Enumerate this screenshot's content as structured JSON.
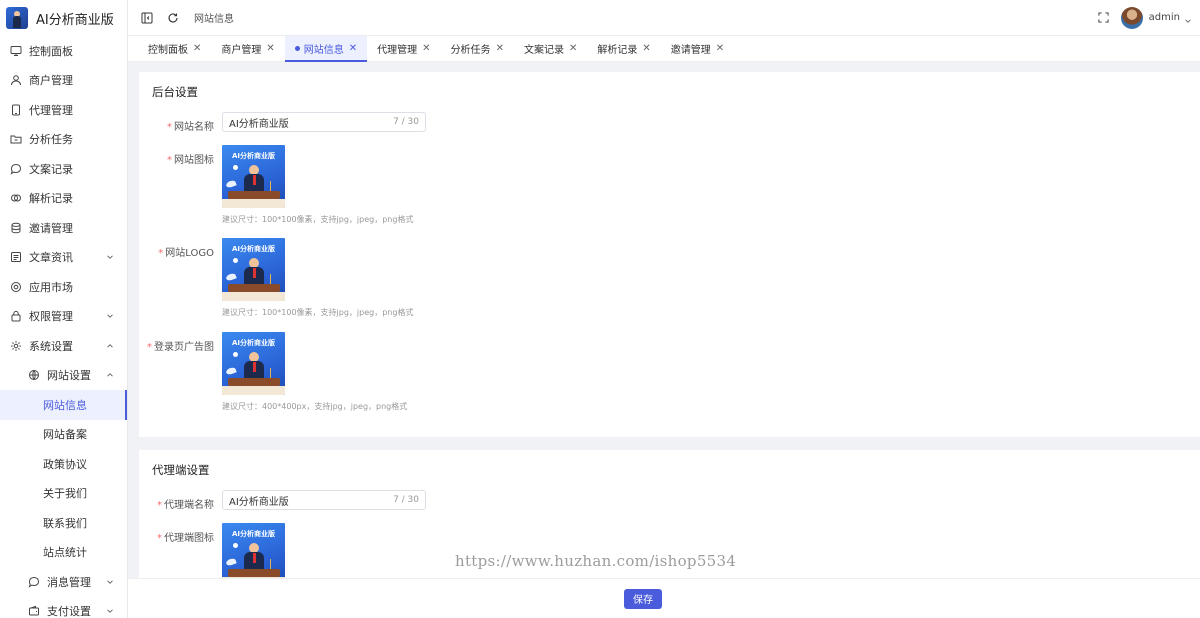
{
  "app": {
    "title": "AI分析商业版"
  },
  "sidebar": {
    "items": [
      {
        "label": "控制面板",
        "icon": "monitor-icon"
      },
      {
        "label": "商户管理",
        "icon": "user-icon"
      },
      {
        "label": "代理管理",
        "icon": "tablet-icon"
      },
      {
        "label": "分析任务",
        "icon": "folder-icon"
      },
      {
        "label": "文案记录",
        "icon": "chat-bubble-icon"
      },
      {
        "label": "解析记录",
        "icon": "link-icon"
      },
      {
        "label": "邀请管理",
        "icon": "database-icon"
      },
      {
        "label": "文章资讯",
        "icon": "document-icon",
        "caret": "down"
      },
      {
        "label": "应用市场",
        "icon": "settings-wheel-icon"
      },
      {
        "label": "权限管理",
        "icon": "lock-icon",
        "caret": "down"
      },
      {
        "label": "系统设置",
        "icon": "gear-icon",
        "caret": "up"
      }
    ],
    "sub_group": {
      "label": "网站设置",
      "icon": "globe-icon",
      "caret": "up"
    },
    "sub_items": [
      "网站信息",
      "网站备案",
      "政策协议",
      "关于我们",
      "联系我们",
      "站点统计"
    ],
    "more_groups": [
      {
        "label": "消息管理",
        "icon": "chat-bubble-icon",
        "caret": "down"
      },
      {
        "label": "支付设置",
        "icon": "wallet-icon",
        "caret": "down"
      }
    ]
  },
  "header": {
    "breadcrumb": "网站信息",
    "username": "admin"
  },
  "tabs": [
    "控制面板",
    "商户管理",
    "网站信息",
    "代理管理",
    "分析任务",
    "文案记录",
    "解析记录",
    "邀请管理"
  ],
  "active_tab": "网站信息",
  "backend": {
    "title": "后台设置",
    "site_name_label": "网站名称",
    "site_name_value": "AI分析商业版",
    "site_name_count": "7 / 30",
    "site_icon_label": "网站图标",
    "site_icon_hint": "建议尺寸：100*100像素，支持jpg，jpeg，png格式",
    "site_logo_label": "网站LOGO",
    "site_logo_hint": "建议尺寸：100*100像素，支持jpg，jpeg，png格式",
    "login_ad_label": "登录页广告图",
    "login_ad_hint": "建议尺寸：400*400px，支持jpg，jpeg，png格式"
  },
  "agent": {
    "title": "代理端设置",
    "name_label": "代理端名称",
    "name_value": "AI分析商业版",
    "name_count": "7 / 30",
    "icon_label": "代理端图标"
  },
  "thumb_text": "AI分析商业版",
  "footer": {
    "save_label": "保存"
  },
  "watermark": "https://www.huzhan.com/ishop5534",
  "colors": {
    "accent": "#4a5bdc",
    "required": "#f56c6c"
  }
}
